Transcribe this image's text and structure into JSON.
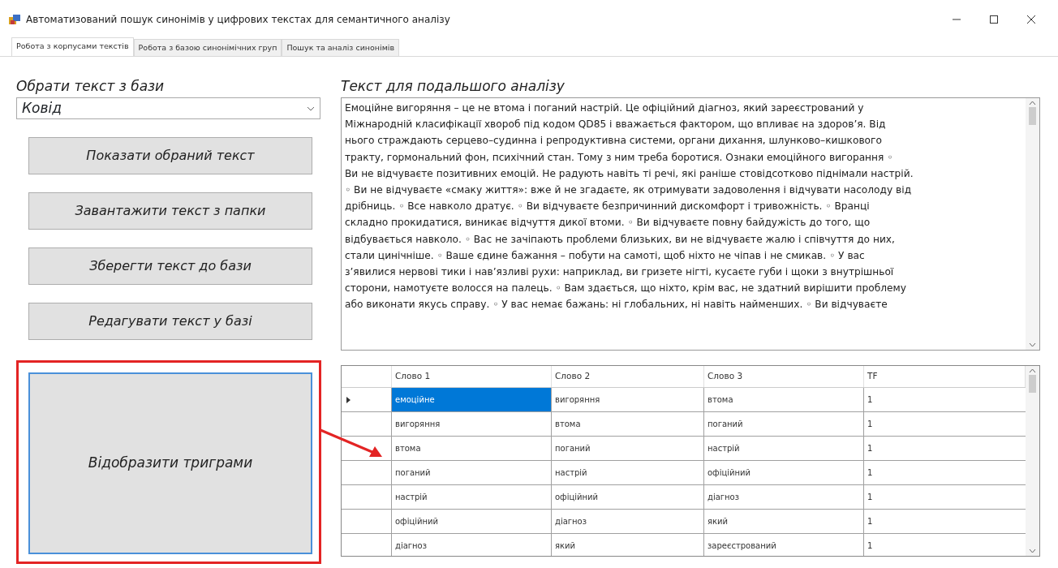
{
  "window": {
    "title": "Автоматизований пошук синонімів у цифрових текстах для семантичного аналізу"
  },
  "tabs": [
    {
      "label": "Робота з корпусами текстів",
      "selected": true
    },
    {
      "label": "Робота з базою синонімічних груп",
      "selected": false
    },
    {
      "label": "Пошук та аналіз синонімів",
      "selected": false
    }
  ],
  "source": {
    "label": "Обрати текст з бази",
    "value": "Ковід"
  },
  "buttons": [
    {
      "label": "Показати обраний текст"
    },
    {
      "label": "Завантажити текст з папки"
    },
    {
      "label": "Зберегти текст до бази"
    },
    {
      "label": "Редагувати текст у базі"
    }
  ],
  "trigram_button": {
    "label": "Відобразити триграми",
    "highlighted": true
  },
  "text_panel": {
    "label": "Текст для подальшого аналізу",
    "lines": [
      "Емоційне вигоряння – це не втома і поганий настрій. Це офіційний діагноз, який зареєстрований у",
      "Міжнародній класифікації хвороб під кодом QD85 і вважається фактором, що впливає на здоров’я. Від",
      "нього страждають серцево–судинна і репродуктивна системи, органи дихання, шлунково–кишкового",
      "тракту, гормональний фон, психічний стан. Тому з ним треба боротися.    Ознаки емоційного вигорання  ◦",
      "Ви не відчуваєте позитивних емоцій. Не радують навіть ті речі, які раніше стовідсотково піднімали настрій.",
      "◦ Ви не відчуваєте «смаку життя»: вже й не згадаєте, як отримувати задоволення і відчувати насолоду від",
      "дрібниць. ◦ Все навколо дратує. ◦ Ви відчуваєте безпричинний дискомфорт і тривожність. ◦ Вранці",
      "складно прокидатися, виникає відчуття дикої втоми. ◦ Ви відчуваєте повну байдужість до того, що",
      "відбувається навколо. ◦ Вас не зачіпають проблеми близьких, ви не відчуваєте жалю і співчуття до них,",
      "стали цинічніше. ◦ Ваше єдине бажання – побути на самоті, щоб ніхто не чіпав і не смикав. ◦ У вас",
      "з’явилися нервові тики і нав’язливі рухи: наприклад, ви гризете нігті, кусаєте губи і щоки з внутрішньої",
      "сторони, намотуєте волосся на палець. ◦ Вам здається, що ніхто, крім вас, не здатний вирішити проблему",
      "або виконати якусь справу. ◦ У вас немає бажань: ні глобальних, ні навіть найменших. ◦ Ви відчуваєте"
    ]
  },
  "table": {
    "columns": [
      "Слово 1",
      "Слово 2",
      "Слово 3",
      "TF"
    ],
    "rows": [
      {
        "cells": [
          "емоційне",
          "вигоряння",
          "втома",
          "1"
        ],
        "selected": true
      },
      {
        "cells": [
          "вигоряння",
          "втома",
          "поганий",
          "1"
        ],
        "selected": false
      },
      {
        "cells": [
          "втома",
          "поганий",
          "настрій",
          "1"
        ],
        "selected": false
      },
      {
        "cells": [
          "поганий",
          "настрій",
          "офіційний",
          "1"
        ],
        "selected": false
      },
      {
        "cells": [
          "настрій",
          "офіційний",
          "діагноз",
          "1"
        ],
        "selected": false
      },
      {
        "cells": [
          "офіційний",
          "діагноз",
          "який",
          "1"
        ],
        "selected": false
      },
      {
        "cells": [
          "діагноз",
          "який",
          "зареєстрований",
          "1"
        ],
        "selected": false
      }
    ]
  }
}
